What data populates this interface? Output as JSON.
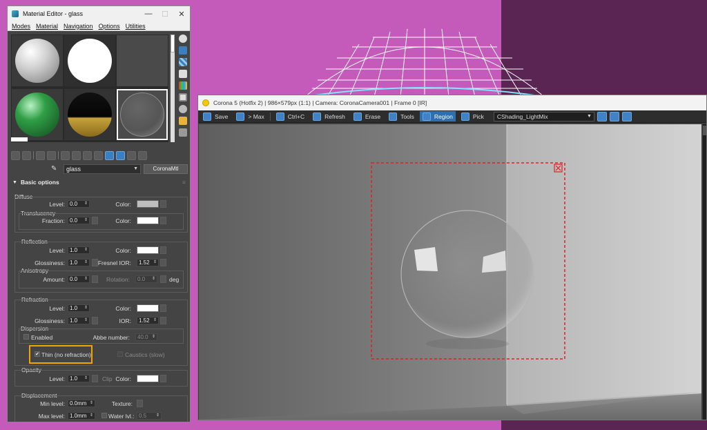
{
  "colors": {
    "desktop_left": "#c45ab9",
    "desktop_right": "#5a2453",
    "wireframe": "#ffffff",
    "highlight": "#f4a300",
    "region": "#e02020",
    "accent": "#3f83c6"
  },
  "material_editor": {
    "title": "Material Editor - glass",
    "menu": [
      "Modes",
      "Material",
      "Navigation",
      "Options",
      "Utilities"
    ],
    "slot_materials": [
      "white-diffuse",
      "white-self-illum",
      "grey-empty",
      "green-glossy",
      "gold-chrome",
      "glass"
    ],
    "side_tool_icons": [
      "sphere-icon",
      "backlight-icon",
      "checker-icon",
      "cube-icon",
      "color-check-icon",
      "video-icon",
      "options-icon",
      "select-by-material-icon",
      "material-navigator-icon"
    ],
    "toolbar_icons": [
      "get-material-icon",
      "put-to-scene-icon",
      "assign-icon",
      "delete-icon",
      "make-unique-icon",
      "save-library-icon",
      "put-library-icon",
      "material-id-icon",
      "show-shaded-icon",
      "show-end-result-icon",
      "go-to-parent-icon",
      "go-forward-icon"
    ],
    "material_name": "glass",
    "material_type": "CoronaMtl",
    "panel_title": "Basic options",
    "diffuse": {
      "title": "Diffuse",
      "level_label": "Level:",
      "level": "0.0",
      "color_label": "Color:",
      "color": "#bdbdbd",
      "translucency_title": "Translucency",
      "fraction_label": "Fraction:",
      "fraction": "0.0",
      "trans_color_label": "Color:",
      "trans_color": "#ffffff"
    },
    "reflection": {
      "title": "Reflection",
      "level_label": "Level:",
      "level": "1.0",
      "color_label": "Color:",
      "color": "#ffffff",
      "gloss_label": "Glossiness:",
      "gloss": "1.0",
      "ior_label": "Fresnel IOR:",
      "ior": "1.52",
      "aniso_title": "Anisotropy",
      "amount_label": "Amount:",
      "amount": "0.0",
      "rotation_label": "Rotation:",
      "rotation": "0.0",
      "rotation_unit": "deg"
    },
    "refraction": {
      "title": "Refraction",
      "level_label": "Level:",
      "level": "1.0",
      "color_label": "Color:",
      "color": "#ffffff",
      "gloss_label": "Glossiness:",
      "gloss": "1.0",
      "ior_label": "IOR:",
      "ior": "1.52",
      "dispersion_title": "Dispersion",
      "enabled_label": "Enabled",
      "abbe_label": "Abbe number:",
      "abbe": "40.0",
      "thin_label": "Thin (no refraction)",
      "thin_checked": true,
      "caustics_label": "Caustics (slow)"
    },
    "opacity": {
      "title": "Opacity",
      "level_label": "Level:",
      "level": "1.0",
      "clip_label": "Clip",
      "color_label": "Color:",
      "color": "#ffffff"
    },
    "displacement": {
      "title": "Displacement",
      "min_label": "Min level:",
      "min": "0.0mm",
      "texture_label": "Texture:",
      "max_label": "Max level:",
      "max": "1.0mm",
      "water_label": "Water lvl.:",
      "water": "0.5"
    }
  },
  "vfb": {
    "title": "Corona 5 (Hotfix 2) | 986×579px (1:1) | Camera: CoronaCamera001 | Frame 0 [IR]",
    "tools": [
      {
        "label": "Save",
        "icon": "save-icon",
        "active": false
      },
      {
        "label": "> Max",
        "icon": "to-max-icon",
        "active": false
      },
      {
        "label": "Ctrl+C",
        "icon": "copy-icon",
        "active": false
      },
      {
        "label": "Refresh",
        "icon": "refresh-icon",
        "active": false
      },
      {
        "label": "Erase",
        "icon": "erase-icon",
        "active": false
      },
      {
        "label": "Tools",
        "icon": "tools-icon",
        "active": false
      },
      {
        "label": "Region",
        "icon": "region-icon",
        "active": true
      },
      {
        "label": "Pick",
        "icon": "pick-icon",
        "active": false
      }
    ],
    "render_pass": "CShading_LightMix",
    "zoom_icons": [
      "zoom-in-icon",
      "zoom-out-icon",
      "zoom-fit-icon"
    ]
  }
}
